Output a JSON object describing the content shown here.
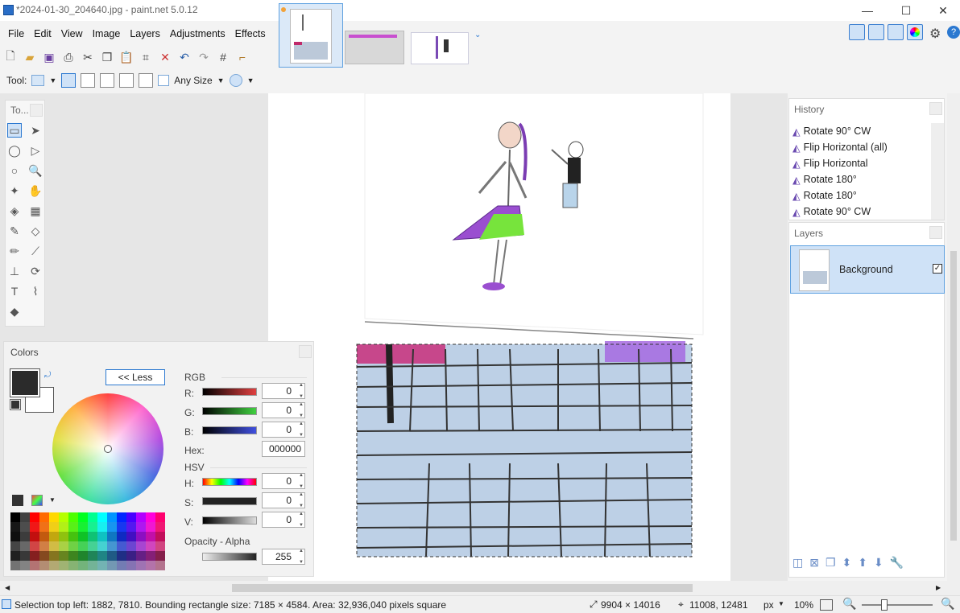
{
  "window": {
    "title": "*2024-01-30_204640.jpg - paint.net 5.0.12",
    "minimize": "—",
    "maximize": "☐",
    "close": "✕"
  },
  "menu": [
    "File",
    "Edit",
    "View",
    "Image",
    "Layers",
    "Adjustments",
    "Effects"
  ],
  "toolbar2": {
    "tool_label": "Tool:",
    "size_mode": "Any Size"
  },
  "tools_panel": {
    "title": "To..."
  },
  "colors": {
    "title": "Colors",
    "less_button": "<< Less",
    "rgb_label": "RGB",
    "r_label": "R:",
    "g_label": "G:",
    "b_label": "B:",
    "r_value": "0",
    "g_value": "0",
    "b_value": "0",
    "hex_label": "Hex:",
    "hex_value": "000000",
    "hsv_label": "HSV",
    "h_label": "H:",
    "s_label": "S:",
    "v_label": "V:",
    "h_value": "0",
    "s_value": "0",
    "v_value": "0",
    "alpha_label": "Opacity - Alpha",
    "alpha_value": "255",
    "primary": "#2b2b2b",
    "secondary": "#ffffff"
  },
  "history": {
    "title": "History",
    "items": [
      "Rotate 90° CW",
      "Flip Horizontal (all)",
      "Flip Horizontal",
      "Rotate 180°",
      "Rotate 180°",
      "Rotate 90° CW"
    ]
  },
  "layers": {
    "title": "Layers",
    "items": [
      {
        "name": "Background",
        "visible": true
      }
    ]
  },
  "status": {
    "selection": "Selection top left: 1882, 7810. Bounding rectangle size: 7185 × 4584. Area: 32,936,040 pixels square",
    "image_size": "9904 × 14016",
    "cursor": "11008, 12481",
    "units": "px",
    "zoom": "10%"
  },
  "palette": [
    "#000000",
    "#404040",
    "#ff0000",
    "#ff6a00",
    "#ffd800",
    "#b6ff00",
    "#4cff00",
    "#00ff21",
    "#00ff90",
    "#00ffff",
    "#0094ff",
    "#0026ff",
    "#4800ff",
    "#b200ff",
    "#ff00dc",
    "#ff006e"
  ]
}
